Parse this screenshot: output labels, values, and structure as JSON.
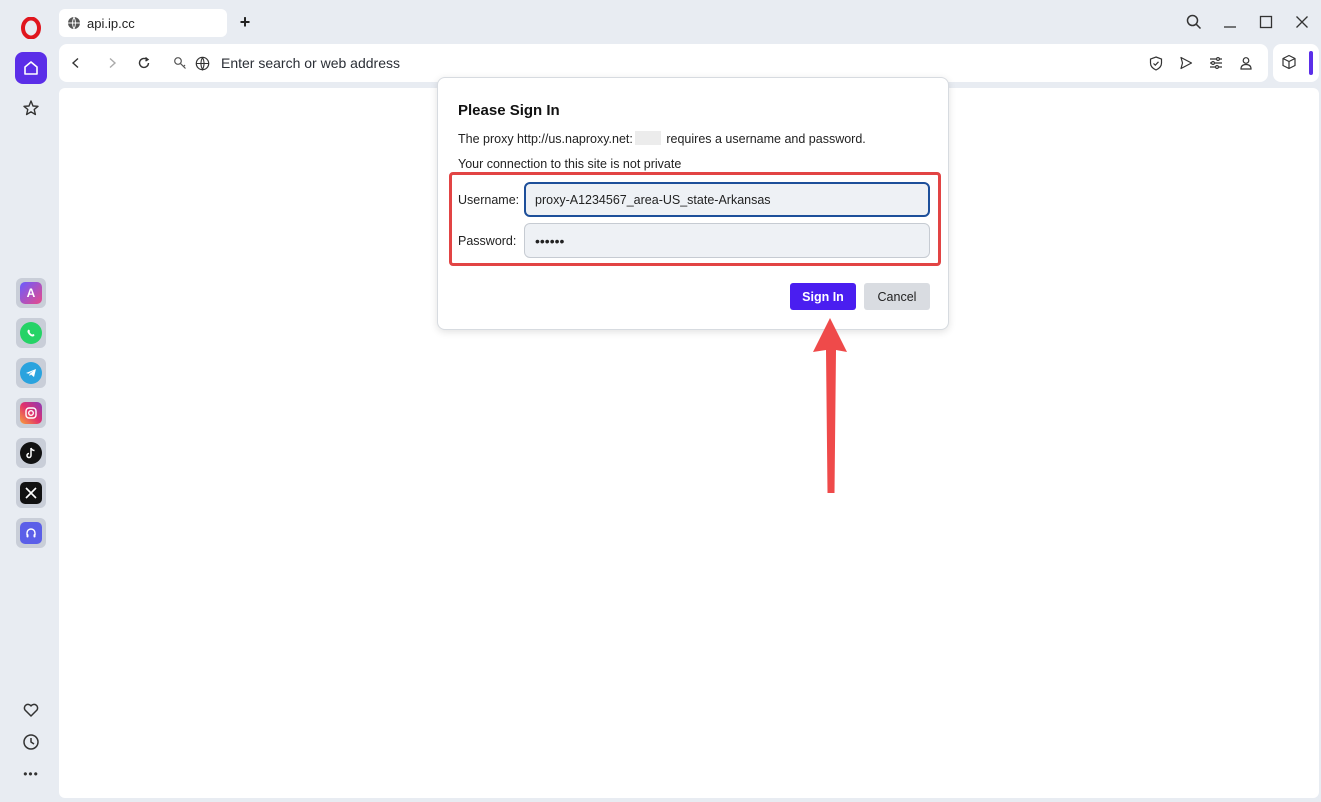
{
  "browser": {
    "tab": {
      "title": "api.ip.cc",
      "icon": "globe-icon"
    },
    "new_tab_label": "+",
    "address_bar": {
      "placeholder": "Enter search or web address"
    },
    "accent_color": "#5b2ee8"
  },
  "sidebar": {
    "top_items": [
      {
        "name": "opera-logo",
        "icon": "opera-logo-icon"
      },
      {
        "name": "home",
        "icon": "home-icon"
      },
      {
        "name": "speed-dial",
        "icon": "star-icon"
      }
    ],
    "apps": [
      {
        "name": "aria-ai",
        "icon": "aria-icon"
      },
      {
        "name": "whatsapp",
        "icon": "whatsapp-icon",
        "color": "#25d366"
      },
      {
        "name": "telegram",
        "icon": "telegram-icon",
        "color": "#2aa3de"
      },
      {
        "name": "instagram",
        "icon": "instagram-icon",
        "color": "#e1306c"
      },
      {
        "name": "tiktok",
        "icon": "tiktok-icon",
        "color": "#111111"
      },
      {
        "name": "x",
        "icon": "x-icon",
        "color": "#111111"
      },
      {
        "name": "music",
        "icon": "headphones-icon",
        "color": "#5b5fe8"
      }
    ],
    "bottom_items": [
      {
        "name": "favorites",
        "icon": "heart-icon"
      },
      {
        "name": "history",
        "icon": "clock-icon"
      },
      {
        "name": "more",
        "icon": "more-icon",
        "label": "•••"
      }
    ]
  },
  "dialog": {
    "title": "Please Sign In",
    "proxy_line_prefix": "The proxy http://us.naproxy.net:",
    "proxy_line_suffix": "requires a username and password.",
    "private_warning": "Your connection to this site is not private",
    "username_label": "Username:",
    "username_value": "proxy-A1234567_area-US_state-Arkansas",
    "password_label": "Password:",
    "password_value": "••••••",
    "sign_in_label": "Sign In",
    "cancel_label": "Cancel",
    "highlight_color": "#e24444",
    "sign_in_color": "#4a1ef0"
  }
}
